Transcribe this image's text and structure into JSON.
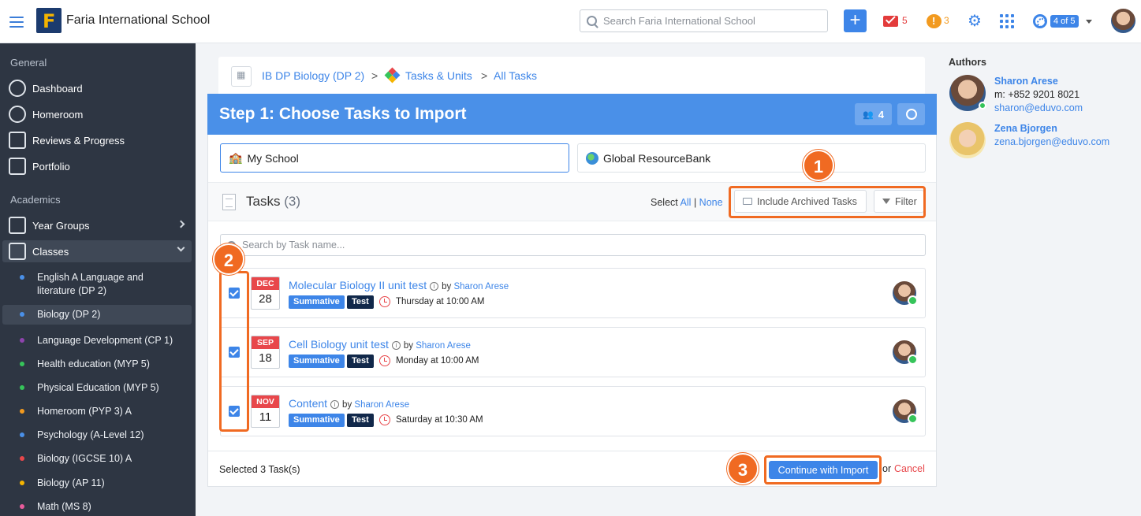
{
  "header": {
    "school_name": "Faria International School",
    "logo_letter": "F",
    "search_placeholder": "Search Faria International School",
    "mail_count": "5",
    "chat_count": "3",
    "steps_badge": "4 of 5"
  },
  "sidebar": {
    "general_label": "General",
    "academics_label": "Academics",
    "general_items": [
      {
        "label": "Dashboard",
        "icon": "dashboard-icon"
      },
      {
        "label": "Homeroom",
        "icon": "homeroom-icon"
      },
      {
        "label": "Reviews & Progress",
        "icon": "chart-icon"
      },
      {
        "label": "Portfolio",
        "icon": "briefcase-icon"
      }
    ],
    "academic_items": [
      {
        "label": "Year Groups",
        "icon": "people-icon"
      },
      {
        "label": "Classes",
        "icon": "classes-icon"
      }
    ],
    "classes": [
      {
        "label": "English A Language and literature (DP 2)",
        "color": "#4a90e8"
      },
      {
        "label": "Biology (DP 2)",
        "color": "#4a90e8"
      },
      {
        "label": "Language Development (CP 1)",
        "color": "#8e44ad"
      },
      {
        "label": "Health education (MYP 5)",
        "color": "#36c45a"
      },
      {
        "label": "Physical Education (MYP 5)",
        "color": "#36c45a"
      },
      {
        "label": "Homeroom (PYP 3) A",
        "color": "#f29a1f"
      },
      {
        "label": "Psychology (A-Level 12)",
        "color": "#4a90e8"
      },
      {
        "label": "Biology (IGCSE 10) A",
        "color": "#e8474b"
      },
      {
        "label": "Biology (AP 11)",
        "color": "#f5b400"
      },
      {
        "label": "Math (MS 8)",
        "color": "#e85c9c"
      }
    ]
  },
  "breadcrumb": {
    "class": "IB DP Biology (DP 2)",
    "tasks_units": "Tasks & Units",
    "all_tasks": "All Tasks",
    "sep": ">"
  },
  "step": {
    "title": "Step 1: Choose Tasks to Import",
    "people_count": "4"
  },
  "sources": {
    "my_school": "My School",
    "global": "Global ResourceBank"
  },
  "tasks_header": {
    "title": "Tasks",
    "count": "(3)",
    "select_label": "Select",
    "all": "All",
    "pipe": "|",
    "none": "None",
    "include_archived": "Include Archived Tasks",
    "filter": "Filter",
    "search_placeholder": "Search by Task name..."
  },
  "tasks": [
    {
      "month": "DEC",
      "day": "28",
      "title": "Molecular Biology II unit test",
      "by": "by",
      "author": "Sharon Arese",
      "type": "Summative",
      "kind": "Test",
      "time": "Thursday at 10:00 AM"
    },
    {
      "month": "SEP",
      "day": "18",
      "title": "Cell Biology unit test",
      "by": "by",
      "author": "Sharon Arese",
      "type": "Summative",
      "kind": "Test",
      "time": "Monday at 10:00 AM"
    },
    {
      "month": "NOV",
      "day": "11",
      "title": "Content",
      "by": "by",
      "author": "Sharon Arese",
      "type": "Summative",
      "kind": "Test",
      "time": "Saturday at 10:30 AM"
    }
  ],
  "footer": {
    "selected": "Selected 3 Task(s)",
    "continue": "Continue with Import",
    "or": "or",
    "cancel": "Cancel"
  },
  "annotations": {
    "one": "1",
    "two": "2",
    "three": "3",
    "color": "#f06a22"
  },
  "authors": {
    "heading": "Authors",
    "list": [
      {
        "name": "Sharon Arese",
        "phone": "m: +852 9201 8021",
        "email": "sharon@eduvo.com"
      },
      {
        "name": "Zena Bjorgen",
        "email": "zena.bjorgen@eduvo.com"
      }
    ]
  }
}
